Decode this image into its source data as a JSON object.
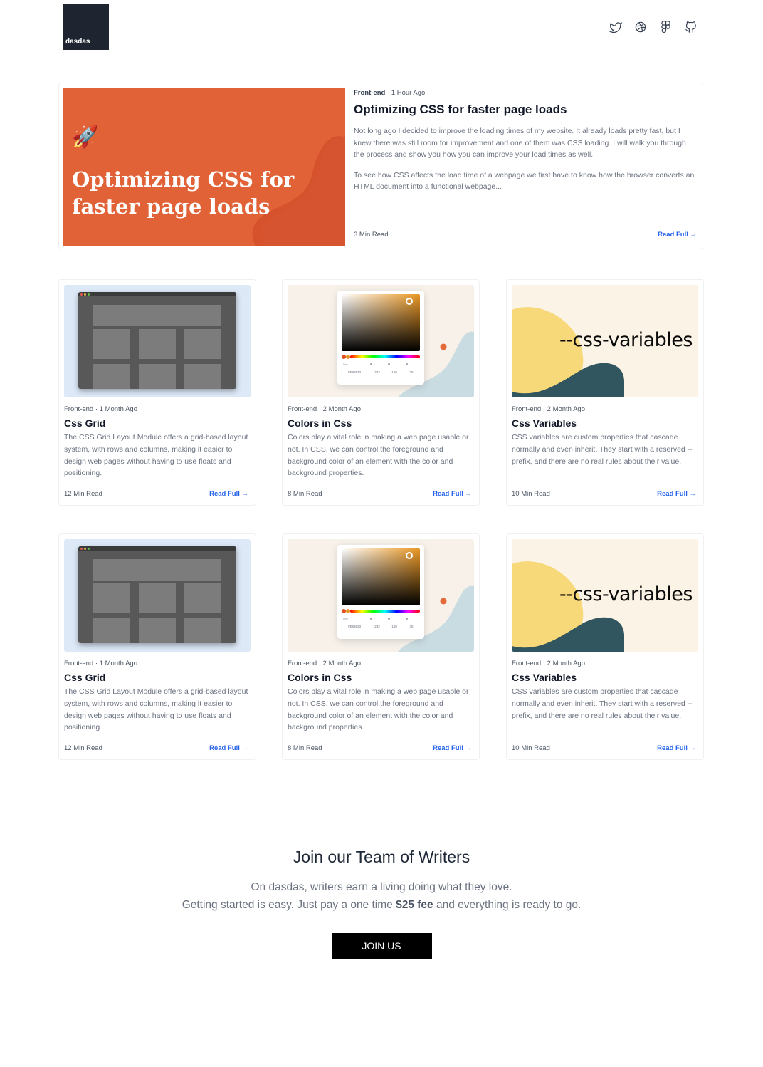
{
  "header": {
    "logo_text": "dasdas",
    "social_icons": [
      "twitter-icon",
      "dribbble-icon",
      "figma-icon",
      "github-icon"
    ],
    "separator": "·"
  },
  "featured": {
    "category": "Front-end",
    "time": "1 Hour Ago",
    "meta_separator": "·",
    "image_title": "Optimizing CSS for faster page loads",
    "image_emoji": "🚀",
    "title": "Optimizing CSS for faster page loads",
    "paragraph1": "Not long ago I decided to improve the loading times of my website. It already loads pretty fast, but I knew there was still room for improvement and one of them was CSS loading. I will walk you through the process and show you how you can improve your load times as well.",
    "paragraph2": "To see how CSS affects the load time of a webpage we first have to know how the browser converts an HTML document into a functional webpage...",
    "read_time": "3 Min Read",
    "read_full": "Read Full →"
  },
  "cards": [
    {
      "thumb": "grid",
      "category": "Front-end",
      "time": "1 Month Ago",
      "title": "Css Grid",
      "desc": "The CSS Grid Layout Module offers a grid-based layout system, with rows and columns, making it easier to design web pages without having to use floats and positioning.",
      "read_time": "12 Min Read",
      "read_full": "Read Full →"
    },
    {
      "thumb": "colors",
      "category": "Front-end",
      "time": "2 Month Ago",
      "title": "Colors in Css",
      "desc": "Colors play a vital role in making a web page usable or not. In CSS, we can control the foreground and background color of an element with the color and background properties.",
      "read_time": "8 Min Read",
      "read_full": "Read Full →"
    },
    {
      "thumb": "variables",
      "category": "Front-end",
      "time": "2 Month Ago",
      "title": "Css Variables",
      "desc": "CSS variables are custom properties that cascade normally and even inherit. They start with a reserved -- prefix, and there are no real rules about their value.",
      "read_time": "10 Min Read",
      "read_full": "Read Full →"
    },
    {
      "thumb": "grid",
      "category": "Front-end",
      "time": "1 Month Ago",
      "title": "Css Grid",
      "desc": "The CSS Grid Layout Module offers a grid-based layout system, with rows and columns, making it easier to design web pages without having to use floats and positioning.",
      "read_time": "12 Min Read",
      "read_full": "Read Full →"
    },
    {
      "thumb": "colors",
      "category": "Front-end",
      "time": "2 Month Ago",
      "title": "Colors in Css",
      "desc": "Colors play a vital role in making a web page usable or not. In CSS, we can control the foreground and background color of an element with the color and background properties.",
      "read_time": "8 Min Read",
      "read_full": "Read Full →"
    },
    {
      "thumb": "variables",
      "category": "Front-end",
      "time": "2 Month Ago",
      "title": "Css Variables",
      "desc": "CSS variables are custom properties that cascade normally and even inherit. They start with a reserved -- prefix, and there are no real rules about their value.",
      "read_time": "10 Min Read",
      "read_full": "Read Full →"
    }
  ],
  "thumb_text": {
    "variables_label": "--css-variables",
    "picker_hex": "#E89623",
    "picker_r": "232",
    "picker_g": "150",
    "picker_b": "35",
    "picker_hex_label": "Hex"
  },
  "cta": {
    "heading": "Join our Team of Writers",
    "line1": "On dasdas, writers earn a living doing what they love.",
    "line2_before": "Getting started is easy. Just pay a one time ",
    "line2_bold": "$25 fee",
    "line2_after": " and everything is ready to go.",
    "button": "JOIN US"
  },
  "colors": {
    "featured_bg": "#e06236",
    "link": "#2563eb",
    "button_bg": "#000000",
    "logo_bg": "#1e2530"
  }
}
